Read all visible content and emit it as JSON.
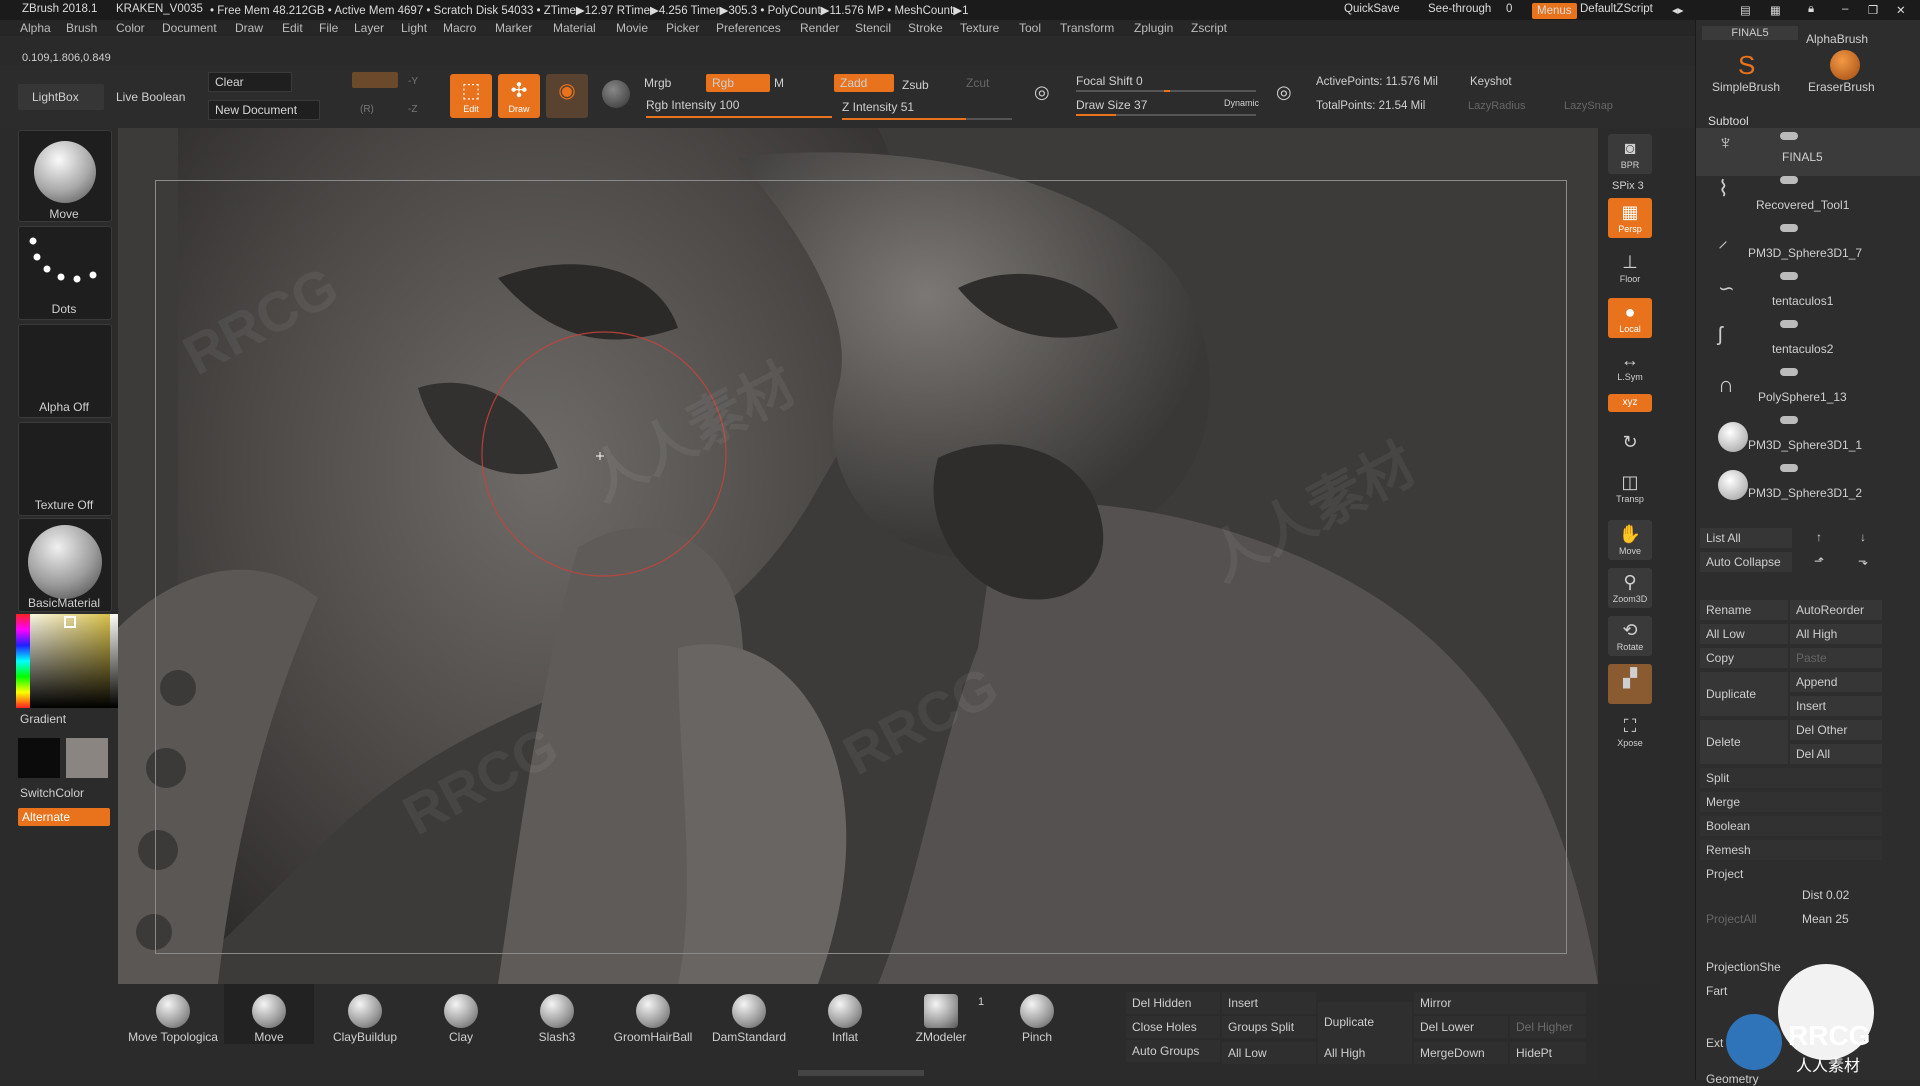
{
  "title_bar": {
    "app": "ZBrush 2018.1",
    "document": "KRAKEN_V0035",
    "stats": "• Free Mem 48.212GB • Active Mem 4697 • Scratch Disk 54033 • ZTime▶12.97 RTime▶4.256 Timer▶305.3 • PolyCount▶11.576 MP • MeshCount▶1",
    "quicksave": "QuickSave",
    "see_through": "See-through",
    "see_through_value": "0",
    "menus": "Menus",
    "default_zscript": "DefaultZScript"
  },
  "menu_items": [
    "Alpha",
    "Brush",
    "Color",
    "Document",
    "Draw",
    "Edit",
    "File",
    "Layer",
    "Light",
    "Macro",
    "Marker",
    "Material",
    "Movie",
    "Picker",
    "Preferences",
    "Render",
    "Stencil",
    "Stroke",
    "Texture",
    "Tool",
    "Transform",
    "Zplugin",
    "Zscript"
  ],
  "coords": "0.109,1.806,0.849",
  "toolbar": {
    "lightbox": "LightBox",
    "live_boolean": "Live Boolean",
    "clear": "Clear",
    "new_document": "New Document",
    "edit": "Edit",
    "draw": "Draw",
    "mrgb": "Mrgb",
    "rgb": "Rgb",
    "m": "M",
    "rgb_intensity": "Rgb Intensity 100",
    "zadd": "Zadd",
    "zsub": "Zsub",
    "zcut": "Zcut",
    "z_intensity": "Z Intensity 51",
    "focal_shift": "Focal Shift 0",
    "draw_size": "Draw Size 37",
    "dynamic": "Dynamic",
    "active_points": "ActivePoints: 11.576 Mil",
    "total_points": "TotalPoints: 21.54 Mil",
    "keyshot": "Keyshot",
    "lazy_radius": "LazyRadius",
    "lazy_snap": "LazySnap"
  },
  "left_panel": {
    "brush": "Move",
    "stroke": "Dots",
    "alpha": "Alpha Off",
    "texture": "Texture Off",
    "material": "BasicMaterial",
    "gradient": "Gradient",
    "switch_color": "SwitchColor",
    "alternate": "Alternate",
    "main_color": "#d8c14a",
    "secondary_color": "#0b0b0b",
    "tertiary_color": "#8a8580"
  },
  "right_column": [
    {
      "name": "BPR",
      "on": false
    },
    {
      "name": "SPix 3",
      "on": false
    },
    {
      "name": "Persp",
      "on": true
    },
    {
      "name": "Floor",
      "on": false
    },
    {
      "name": "Local",
      "on": true
    },
    {
      "name": "L.Sym",
      "on": false
    },
    {
      "name": "Transp",
      "on": false
    },
    {
      "name": "Move",
      "on": false
    },
    {
      "name": "Zoom3D",
      "on": false
    },
    {
      "name": "Rotate",
      "on": false
    },
    {
      "name": "Xpose",
      "on": false
    }
  ],
  "tray": {
    "tool_name": "FINAL5",
    "alpha_brush": "AlphaBrush",
    "simple_brush": "SimpleBrush",
    "eraser_brush": "EraserBrush",
    "subtool_header": "Subtool",
    "subtools": [
      "FINAL5",
      "Recovered_Tool1",
      "PM3D_Sphere3D1_7",
      "tentaculos1",
      "tentaculos2",
      "PolySphere1_13",
      "PM3D_Sphere3D1_1",
      "PM3D_Sphere3D1_2"
    ],
    "list_all": "List All",
    "auto_collapse": "Auto Collapse",
    "rename": "Rename",
    "auto_reorder": "AutoReorder",
    "all_low": "All Low",
    "all_high": "All High",
    "copy": "Copy",
    "paste": "Paste",
    "duplicate": "Duplicate",
    "append": "Append",
    "insert": "Insert",
    "delete": "Delete",
    "del_other": "Del Other",
    "del_all": "Del All",
    "split": "Split",
    "merge": "Merge",
    "boolean": "Boolean",
    "remesh": "Remesh",
    "project": "Project",
    "dist": "Dist 0.02",
    "mean": "Mean 25",
    "project_all": "ProjectAll",
    "projection_shell": "ProjectionShe",
    "farthest": "Fart",
    "extract": "Ext",
    "geometry": "Geometry"
  },
  "bottom_brushes": [
    "Move Topologica",
    "Move",
    "ClayBuildup",
    "Clay",
    "Slash3",
    "GroomHairBall",
    "DamStandard",
    "Inflat",
    "ZModeler",
    "Pinch"
  ],
  "bottom_zmodeler_count": "1",
  "bottom_buttons": {
    "del_hidden": "Del Hidden",
    "insert": "Insert",
    "duplicate": "Duplicate",
    "mirror": "Mirror",
    "close_holes": "Close Holes",
    "groups_split": "Groups Split",
    "del_lower": "Del Lower",
    "del_higher": "Del Higher",
    "auto_groups": "Auto Groups",
    "all_low": "All Low",
    "all_high": "All High",
    "merge_down": "MergeDown",
    "hide_pt": "HidePt"
  },
  "watermark": "RRCG",
  "watermark_cn": "人人素材"
}
